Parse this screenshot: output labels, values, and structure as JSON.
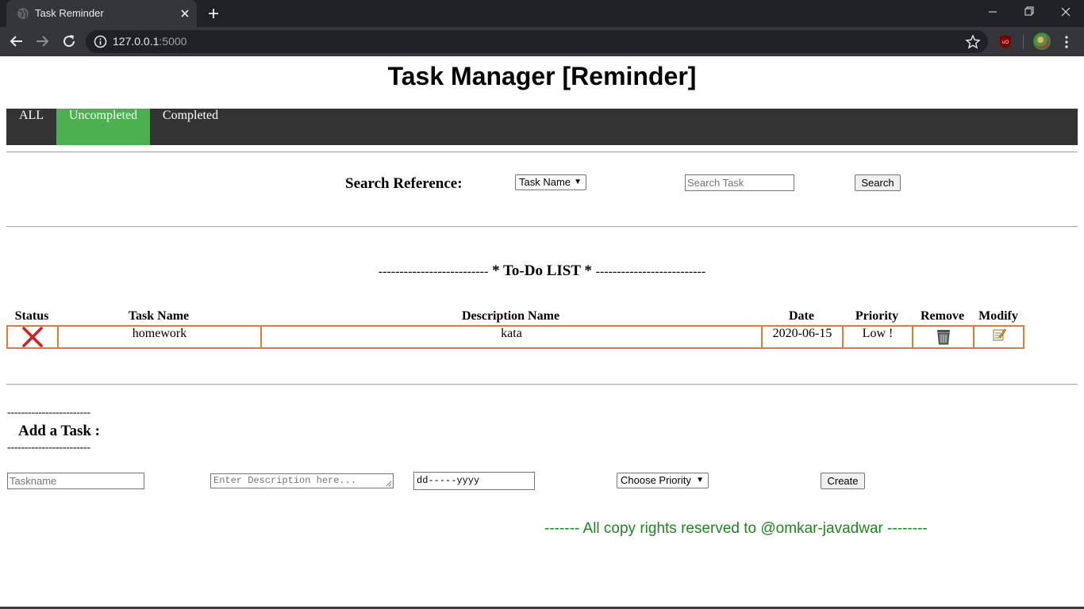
{
  "browser": {
    "tab_title": "Task Reminder",
    "url_host": "127.0.0.1",
    "url_port": ":5000"
  },
  "page": {
    "title": "Task Manager [Reminder]",
    "nav": [
      {
        "label": "ALL",
        "active": false
      },
      {
        "label": "Uncompleted",
        "active": true
      },
      {
        "label": "Completed",
        "active": false
      }
    ],
    "nav_active_color": "#4caf50",
    "nav_bg_color": "#333333"
  },
  "search": {
    "label": "Search Reference:",
    "reference_selected": "Task Name",
    "input_placeholder": "Search Task",
    "button_label": "Search"
  },
  "todo": {
    "heading_left": "--------------------------",
    "heading": "* To-Do LIST *",
    "heading_right": "--------------------------",
    "columns": [
      "Status",
      "Task Name",
      "Description Name",
      "Date",
      "Priority",
      "Remove",
      "Modify"
    ],
    "rows": [
      {
        "status_icon": "red-x-icon",
        "task_name": "homework",
        "description": "kata",
        "date": "2020-06-15",
        "priority": "Low !",
        "remove_icon": "trash-icon",
        "modify_icon": "edit-memo-icon"
      }
    ],
    "border_color": "#e07b39"
  },
  "add_task": {
    "dash_top": "------------------------",
    "title": "Add a Task :",
    "dash_bottom": "------------------------",
    "taskname_placeholder": "Taskname",
    "description_placeholder": "Enter Description here...",
    "date_value": "dd-----yyyy",
    "priority_selected": "Choose Priority",
    "create_label": "Create"
  },
  "footer": {
    "text": "------- All copy rights reserved to @omkar-javadwar --------",
    "color": "#1a8a1a"
  }
}
